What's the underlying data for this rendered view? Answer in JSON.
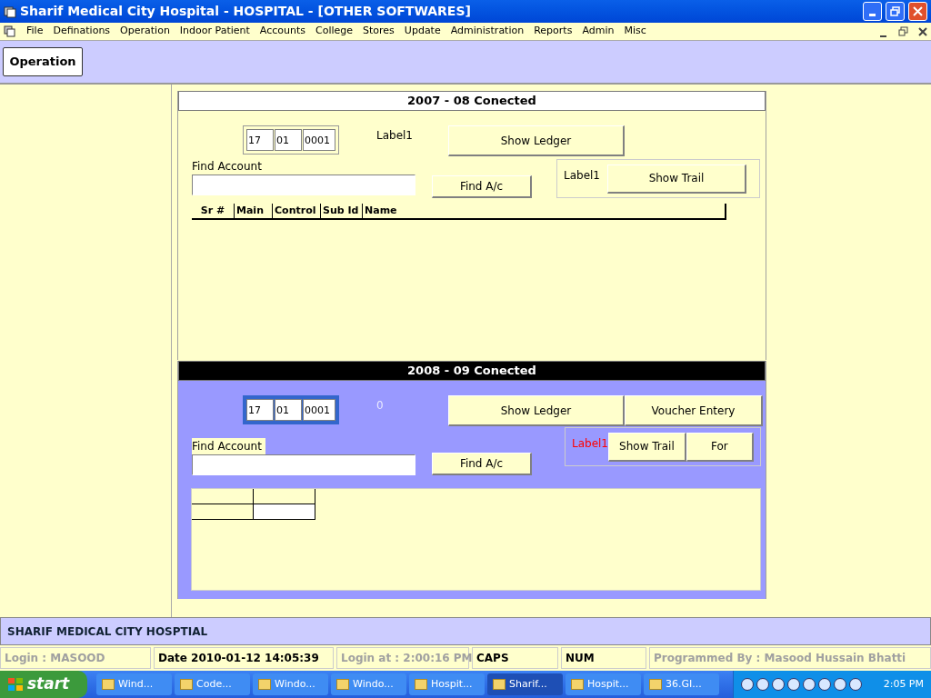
{
  "window": {
    "title": "Sharif Medical City Hospital - HOSPITAL - [OTHER SOFTWARES]"
  },
  "menu": [
    "File",
    "Definations",
    "Operation",
    "Indoor Patient",
    "Accounts",
    "College",
    "Stores",
    "Update",
    "Administration",
    "Reports",
    "Admin",
    "Misc"
  ],
  "toolbar": {
    "button": "Operation"
  },
  "sections": [
    {
      "kind": "plain",
      "header": "2007 - 08 Conected",
      "code": [
        "17",
        "01",
        "0001"
      ],
      "info": "Label1",
      "ledger_buttons": [
        "Show Ledger"
      ],
      "find_label": "Find Account",
      "find_button": "Find A/c",
      "trail_label": "Label1",
      "trail_buttons": [
        "Show Trail"
      ],
      "columns": [
        "Sr #",
        "Main",
        "Control",
        "Sub Id",
        "Name"
      ]
    },
    {
      "kind": "active",
      "header": "2008 - 09 Conected",
      "code": [
        "17",
        "01",
        "0001"
      ],
      "info": "0",
      "ledger_buttons": [
        "Show Ledger",
        "Voucher Entery"
      ],
      "find_label": "Find Account",
      "find_button": "Find A/c",
      "trail_label": "Label1",
      "trail_buttons": [
        "Show Trail",
        "For"
      ]
    }
  ],
  "footer": {
    "title": "SHARIF MEDICAL CITY HOSPTIAL"
  },
  "status_bar": [
    {
      "text": "Login :  MASOOD",
      "enabled": false
    },
    {
      "text": "Date 2010-01-12 14:05:39",
      "enabled": true
    },
    {
      "text": "Login at : 2:00:16 PM",
      "enabled": false
    },
    {
      "text": "CAPS",
      "enabled": true
    },
    {
      "text": "NUM",
      "enabled": true
    },
    {
      "text": "Programmed By : Masood Hussain Bhatti",
      "enabled": false
    }
  ],
  "taskbar": {
    "start": "start",
    "items": [
      {
        "label": "Wind...",
        "selected": false
      },
      {
        "label": "Code...",
        "selected": false
      },
      {
        "label": "Windo...",
        "selected": false
      },
      {
        "label": "Windo...",
        "selected": false
      },
      {
        "label": "Hospit...",
        "selected": false
      },
      {
        "label": "Sharif...",
        "selected": true
      },
      {
        "label": "Hospit...",
        "selected": false
      },
      {
        "label": "36.GI...",
        "selected": false
      }
    ],
    "clock": "2:05 PM"
  }
}
